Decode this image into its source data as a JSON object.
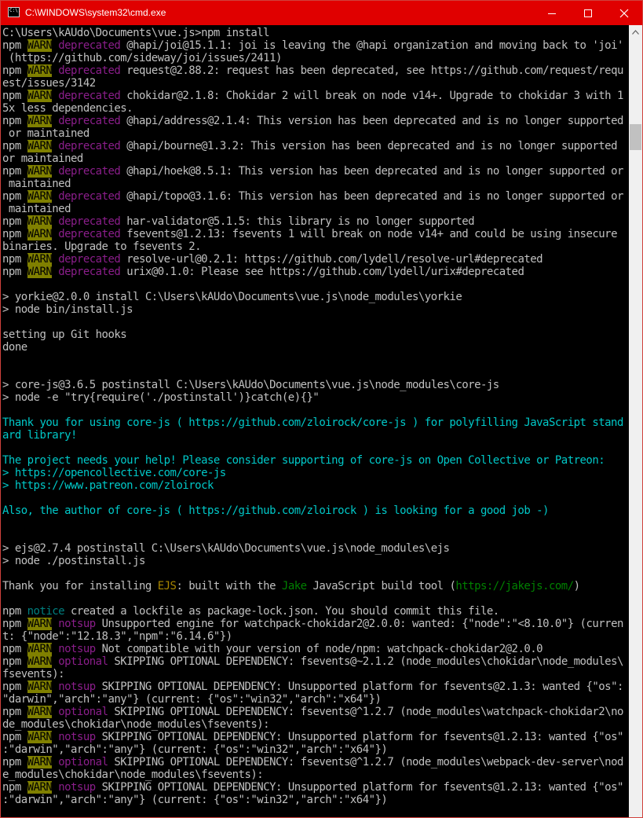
{
  "window": {
    "title": "C:\\WINDOWS\\system32\\cmd.exe",
    "icon_text": "C:\\.",
    "icon": "cmd-icon"
  },
  "controls": {
    "minimize": "minimize-icon",
    "maximize": "maximize-icon",
    "close": "close-icon"
  },
  "colors": {
    "titlebar": "#e00000",
    "warn_bg": "#808000",
    "deprecated": "#8b1e8b",
    "cyan": "#00c8c8",
    "green": "#008000",
    "ejs": "#a88600",
    "notice": "#008080"
  },
  "lines": [
    [
      {
        "t": "C:\\Users\\kAUdo\\Documents\\vue.js>npm install",
        "c": "w"
      }
    ],
    [
      {
        "t": "npm ",
        "c": "w"
      },
      {
        "t": "WARN",
        "c": "warn"
      },
      {
        "t": " ",
        "c": "w"
      },
      {
        "t": "deprecated",
        "c": "mag"
      },
      {
        "t": " @hapi/joi@15.1.1: joi is leaving the @hapi organization and moving back to 'joi'",
        "c": "w"
      }
    ],
    [
      {
        "t": " (https://github.com/sideway/joi/issues/2411)",
        "c": "w"
      }
    ],
    [
      {
        "t": "npm ",
        "c": "w"
      },
      {
        "t": "WARN",
        "c": "warn"
      },
      {
        "t": " ",
        "c": "w"
      },
      {
        "t": "deprecated",
        "c": "mag"
      },
      {
        "t": " request@2.88.2: request has been deprecated, see https://github.com/request/requ",
        "c": "w"
      }
    ],
    [
      {
        "t": "est/issues/3142",
        "c": "w"
      }
    ],
    [
      {
        "t": "npm ",
        "c": "w"
      },
      {
        "t": "WARN",
        "c": "warn"
      },
      {
        "t": " ",
        "c": "w"
      },
      {
        "t": "deprecated",
        "c": "mag"
      },
      {
        "t": " chokidar@2.1.8: Chokidar 2 will break on node v14+. Upgrade to chokidar 3 with 1",
        "c": "w"
      }
    ],
    [
      {
        "t": "5x less dependencies.",
        "c": "w"
      }
    ],
    [
      {
        "t": "npm ",
        "c": "w"
      },
      {
        "t": "WARN",
        "c": "warn"
      },
      {
        "t": " ",
        "c": "w"
      },
      {
        "t": "deprecated",
        "c": "mag"
      },
      {
        "t": " @hapi/address@2.1.4: This version has been deprecated and is no longer supported",
        "c": "w"
      }
    ],
    [
      {
        "t": " or maintained",
        "c": "w"
      }
    ],
    [
      {
        "t": "npm ",
        "c": "w"
      },
      {
        "t": "WARN",
        "c": "warn"
      },
      {
        "t": " ",
        "c": "w"
      },
      {
        "t": "deprecated",
        "c": "mag"
      },
      {
        "t": " @hapi/bourne@1.3.2: This version has been deprecated and is no longer supported",
        "c": "w"
      }
    ],
    [
      {
        "t": "or maintained",
        "c": "w"
      }
    ],
    [
      {
        "t": "npm ",
        "c": "w"
      },
      {
        "t": "WARN",
        "c": "warn"
      },
      {
        "t": " ",
        "c": "w"
      },
      {
        "t": "deprecated",
        "c": "mag"
      },
      {
        "t": " @hapi/hoek@8.5.1: This version has been deprecated and is no longer supported or",
        "c": "w"
      }
    ],
    [
      {
        "t": " maintained",
        "c": "w"
      }
    ],
    [
      {
        "t": "npm ",
        "c": "w"
      },
      {
        "t": "WARN",
        "c": "warn"
      },
      {
        "t": " ",
        "c": "w"
      },
      {
        "t": "deprecated",
        "c": "mag"
      },
      {
        "t": " @hapi/topo@3.1.6: This version has been deprecated and is no longer supported or",
        "c": "w"
      }
    ],
    [
      {
        "t": " maintained",
        "c": "w"
      }
    ],
    [
      {
        "t": "npm ",
        "c": "w"
      },
      {
        "t": "WARN",
        "c": "warn"
      },
      {
        "t": " ",
        "c": "w"
      },
      {
        "t": "deprecated",
        "c": "mag"
      },
      {
        "t": " har-validator@5.1.5: this library is no longer supported",
        "c": "w"
      }
    ],
    [
      {
        "t": "npm ",
        "c": "w"
      },
      {
        "t": "WARN",
        "c": "warn"
      },
      {
        "t": " ",
        "c": "w"
      },
      {
        "t": "deprecated",
        "c": "mag"
      },
      {
        "t": " fsevents@1.2.13: fsevents 1 will break on node v14+ and could be using insecure",
        "c": "w"
      }
    ],
    [
      {
        "t": "binaries. Upgrade to fsevents 2.",
        "c": "w"
      }
    ],
    [
      {
        "t": "npm ",
        "c": "w"
      },
      {
        "t": "WARN",
        "c": "warn"
      },
      {
        "t": " ",
        "c": "w"
      },
      {
        "t": "deprecated",
        "c": "mag"
      },
      {
        "t": " resolve-url@0.2.1: https://github.com/lydell/resolve-url#deprecated",
        "c": "w"
      }
    ],
    [
      {
        "t": "npm ",
        "c": "w"
      },
      {
        "t": "WARN",
        "c": "warn"
      },
      {
        "t": " ",
        "c": "w"
      },
      {
        "t": "deprecated",
        "c": "mag"
      },
      {
        "t": " urix@0.1.0: Please see https://github.com/lydell/urix#deprecated",
        "c": "w"
      }
    ],
    [],
    [
      {
        "t": "> yorkie@2.0.0 install C:\\Users\\kAUdo\\Documents\\vue.js\\node_modules\\yorkie",
        "c": "w"
      }
    ],
    [
      {
        "t": "> node bin/install.js",
        "c": "w"
      }
    ],
    [],
    [
      {
        "t": "setting up Git hooks",
        "c": "w"
      }
    ],
    [
      {
        "t": "done",
        "c": "w"
      }
    ],
    [],
    [],
    [
      {
        "t": "> core-js@3.6.5 postinstall C:\\Users\\kAUdo\\Documents\\vue.js\\node_modules\\core-js",
        "c": "w"
      }
    ],
    [
      {
        "t": "> node -e \"try{require('./postinstall')}catch(e){}\"",
        "c": "w"
      }
    ],
    [],
    [
      {
        "t": "Thank you for using core-js ( https://github.com/zloirock/core-js ) for polyfilling JavaScript stand",
        "c": "cyan"
      }
    ],
    [
      {
        "t": "ard library!",
        "c": "cyan"
      }
    ],
    [],
    [
      {
        "t": "The project needs your help! Please consider supporting of core-js on Open Collective or Patreon:",
        "c": "cyan"
      }
    ],
    [
      {
        "t": "> https://opencollective.com/core-js",
        "c": "cyan"
      }
    ],
    [
      {
        "t": "> https://www.patreon.com/zloirock",
        "c": "cyan"
      }
    ],
    [],
    [
      {
        "t": "Also, the author of core-js ( https://github.com/zloirock ) is looking for a good job -)",
        "c": "cyan"
      }
    ],
    [],
    [],
    [
      {
        "t": "> ejs@2.7.4 postinstall C:\\Users\\kAUdo\\Documents\\vue.js\\node_modules\\ejs",
        "c": "w"
      }
    ],
    [
      {
        "t": "> node ./postinstall.js",
        "c": "w"
      }
    ],
    [],
    [
      {
        "t": "Thank you for installing ",
        "c": "w"
      },
      {
        "t": "EJS",
        "c": "gold"
      },
      {
        "t": ": built with the ",
        "c": "w"
      },
      {
        "t": "Jake",
        "c": "green"
      },
      {
        "t": " JavaScript build tool (",
        "c": "w"
      },
      {
        "t": "https://jakejs.com/",
        "c": "green"
      },
      {
        "t": ")",
        "c": "w"
      }
    ],
    [],
    [
      {
        "t": "npm ",
        "c": "w"
      },
      {
        "t": "notice",
        "c": "dkcyan"
      },
      {
        "t": " created a lockfile as package-lock.json. You should commit this file.",
        "c": "w"
      }
    ],
    [
      {
        "t": "npm ",
        "c": "w"
      },
      {
        "t": "WARN",
        "c": "warn"
      },
      {
        "t": " ",
        "c": "w"
      },
      {
        "t": "notsup",
        "c": "mag"
      },
      {
        "t": " Unsupported engine for watchpack-chokidar2@2.0.0: wanted: {\"node\":\"<8.10.0\"} (curren",
        "c": "w"
      }
    ],
    [
      {
        "t": "t: {\"node\":\"12.18.3\",\"npm\":\"6.14.6\"})",
        "c": "w"
      }
    ],
    [
      {
        "t": "npm ",
        "c": "w"
      },
      {
        "t": "WARN",
        "c": "warn"
      },
      {
        "t": " ",
        "c": "w"
      },
      {
        "t": "notsup",
        "c": "mag"
      },
      {
        "t": " Not compatible with your version of node/npm: watchpack-chokidar2@2.0.0",
        "c": "w"
      }
    ],
    [
      {
        "t": "npm ",
        "c": "w"
      },
      {
        "t": "WARN",
        "c": "warn"
      },
      {
        "t": " ",
        "c": "w"
      },
      {
        "t": "optional",
        "c": "mag"
      },
      {
        "t": " SKIPPING OPTIONAL DEPENDENCY: fsevents@~2.1.2 (node_modules\\chokidar\\node_modules\\",
        "c": "w"
      }
    ],
    [
      {
        "t": "fsevents):",
        "c": "w"
      }
    ],
    [
      {
        "t": "npm ",
        "c": "w"
      },
      {
        "t": "WARN",
        "c": "warn"
      },
      {
        "t": " ",
        "c": "w"
      },
      {
        "t": "notsup",
        "c": "mag"
      },
      {
        "t": " SKIPPING OPTIONAL DEPENDENCY: Unsupported platform for fsevents@2.1.3: wanted {\"os\":",
        "c": "w"
      }
    ],
    [
      {
        "t": "\"darwin\",\"arch\":\"any\"} (current: {\"os\":\"win32\",\"arch\":\"x64\"})",
        "c": "w"
      }
    ],
    [
      {
        "t": "npm ",
        "c": "w"
      },
      {
        "t": "WARN",
        "c": "warn"
      },
      {
        "t": " ",
        "c": "w"
      },
      {
        "t": "optional",
        "c": "mag"
      },
      {
        "t": " SKIPPING OPTIONAL DEPENDENCY: fsevents@^1.2.7 (node_modules\\watchpack-chokidar2\\no",
        "c": "w"
      }
    ],
    [
      {
        "t": "de_modules\\chokidar\\node_modules\\fsevents):",
        "c": "w"
      }
    ],
    [
      {
        "t": "npm ",
        "c": "w"
      },
      {
        "t": "WARN",
        "c": "warn"
      },
      {
        "t": " ",
        "c": "w"
      },
      {
        "t": "notsup",
        "c": "mag"
      },
      {
        "t": " SKIPPING OPTIONAL DEPENDENCY: Unsupported platform for fsevents@1.2.13: wanted {\"os\"",
        "c": "w"
      }
    ],
    [
      {
        "t": ":\"darwin\",\"arch\":\"any\"} (current: {\"os\":\"win32\",\"arch\":\"x64\"})",
        "c": "w"
      }
    ],
    [
      {
        "t": "npm ",
        "c": "w"
      },
      {
        "t": "WARN",
        "c": "warn"
      },
      {
        "t": " ",
        "c": "w"
      },
      {
        "t": "optional",
        "c": "mag"
      },
      {
        "t": " SKIPPING OPTIONAL DEPENDENCY: fsevents@^1.2.7 (node_modules\\webpack-dev-server\\nod",
        "c": "w"
      }
    ],
    [
      {
        "t": "e_modules\\chokidar\\node_modules\\fsevents):",
        "c": "w"
      }
    ],
    [
      {
        "t": "npm ",
        "c": "w"
      },
      {
        "t": "WARN",
        "c": "warn"
      },
      {
        "t": " ",
        "c": "w"
      },
      {
        "t": "notsup",
        "c": "mag"
      },
      {
        "t": " SKIPPING OPTIONAL DEPENDENCY: Unsupported platform for fsevents@1.2.13: wanted {\"os\"",
        "c": "w"
      }
    ],
    [
      {
        "t": ":\"darwin\",\"arch\":\"any\"} (current: {\"os\":\"win32\",\"arch\":\"x64\"})",
        "c": "w"
      }
    ]
  ]
}
